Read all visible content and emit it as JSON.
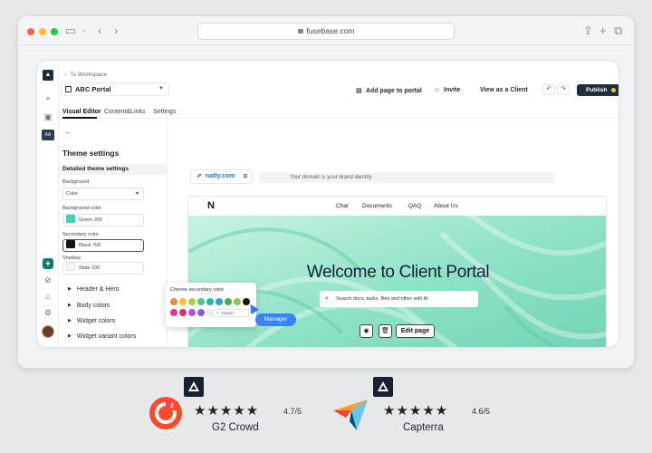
{
  "browser": {
    "url": "fusebase.com"
  },
  "app": {
    "back_link": "← To Workspace",
    "portal_name": "ABC Portal",
    "tabs": [
      "Visual Editor",
      "Content&Links",
      "Settings"
    ],
    "toolbar": {
      "add_page": "Add page to portal",
      "invite": "Invite",
      "view_as_client": "View as a Client",
      "publish": "Publish"
    }
  },
  "panel": {
    "title": "Theme settings",
    "section_title": "Detailed theme settings",
    "background_label": "Background",
    "background_value": "Color",
    "bg_color_label": "Background color",
    "bg_color_value": "Green 200",
    "secondary_label": "Secondary color",
    "secondary_value": "Black 700",
    "shadow_label": "Shadow",
    "shadow_value": "Slate 100",
    "sections": [
      "Header & Hero",
      "Body colors",
      "Widget colors",
      "Widget variant colors"
    ]
  },
  "popup": {
    "title": "Choose secondary color",
    "hex": "111317",
    "colors_row1": [
      "#f28c28",
      "#f5c518",
      "#a8d13b",
      "#3ccf91",
      "#1fb5a8",
      "#2a9fd8",
      "#3ab34a",
      "#8bc34a",
      "#111317"
    ],
    "colors_row2": [
      "#e6398a",
      "#d6336c",
      "#b44fd6",
      "#8e5be0"
    ]
  },
  "manager_label": "Manager",
  "preview": {
    "domain": "natty.com",
    "domain_hint": "Your domain is your brand identity",
    "nav": [
      "Chat",
      "Documents",
      "QAQ",
      "About Us"
    ],
    "hero_title": "Welcome to Client Portal",
    "search_placeholder": "Search docs, tasks, files and other with AI",
    "edit_page": "Edit page"
  },
  "ratings": [
    {
      "name": "G2 Crowd",
      "score": "4.7/5",
      "stars": 4.7
    },
    {
      "name": "Capterra",
      "score": "4.6/5",
      "stars": 4.6
    }
  ]
}
